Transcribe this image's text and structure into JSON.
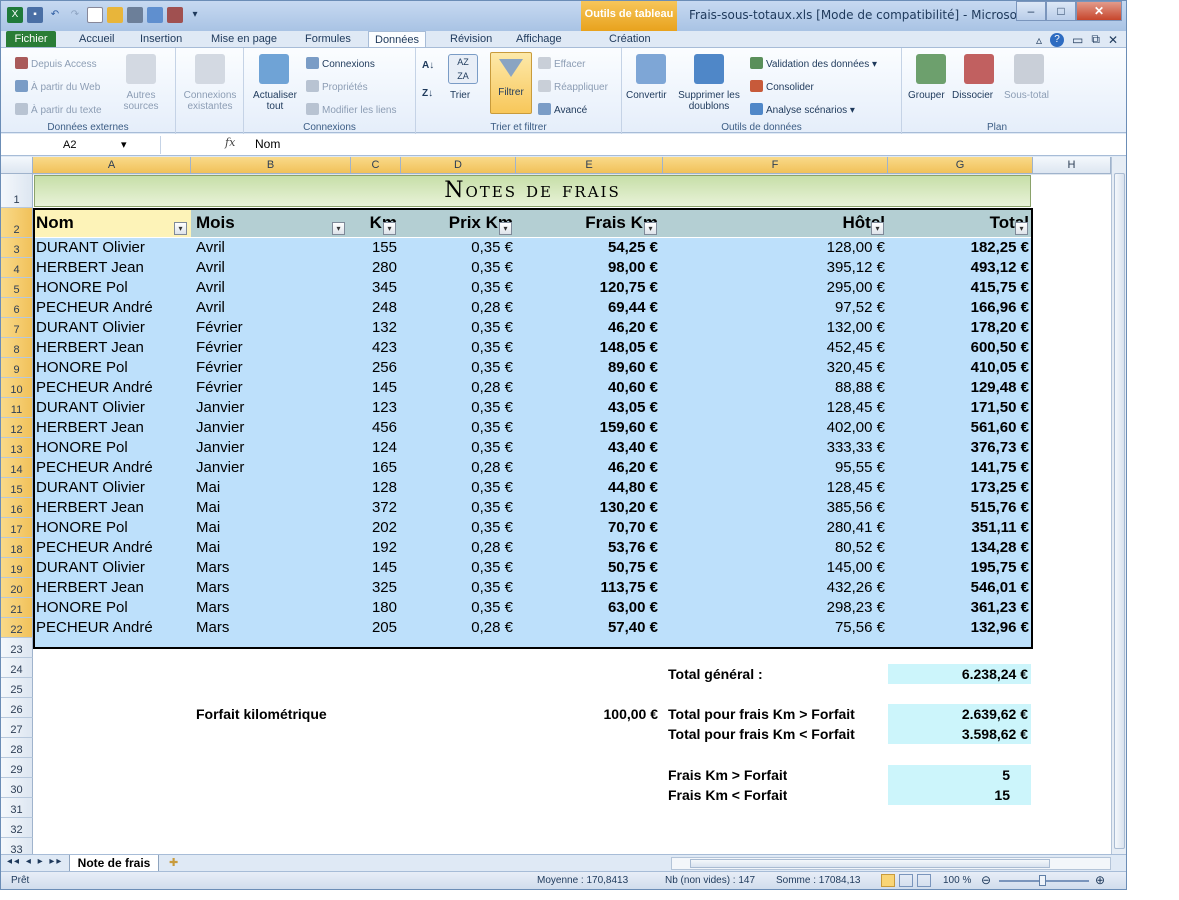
{
  "window": {
    "title": "Frais-sous-totaux.xls  [Mode de compatibilité] - Microsoft Ex...",
    "context_tab": "Outils de tableau"
  },
  "ribbon_tabs": [
    "Fichier",
    "Accueil",
    "Insertion",
    "Mise en page",
    "Formules",
    "Données",
    "Révision",
    "Affichage",
    "Création"
  ],
  "ribbon": {
    "external": {
      "label": "Données externes",
      "access": "Depuis Access",
      "web": "À partir du Web",
      "text": "À partir du texte",
      "other": "Autres sources"
    },
    "existing": "Connexions existantes",
    "connections": {
      "label": "Connexions",
      "refresh": "Actualiser tout",
      "conn": "Connexions",
      "props": "Propriétés",
      "edit": "Modifier les liens"
    },
    "sort": {
      "label": "Trier et filtrer",
      "sort": "Trier",
      "filter": "Filtrer",
      "clear": "Effacer",
      "reapply": "Réappliquer",
      "advanced": "Avancé"
    },
    "tools": {
      "label": "Outils de données",
      "convert": "Convertir",
      "dupes": "Supprimer les doublons",
      "validation": "Validation des données",
      "consolidate": "Consolider",
      "whatif": "Analyse scénarios"
    },
    "plan": {
      "label": "Plan",
      "group": "Grouper",
      "ungroup": "Dissocier",
      "subtotal": "Sous-total"
    }
  },
  "formula": {
    "cell": "A2",
    "fx": "fx",
    "value": "Nom"
  },
  "columns": [
    "A",
    "B",
    "C",
    "D",
    "E",
    "F",
    "G",
    "H"
  ],
  "sheet": {
    "title": "Notes de frais",
    "headers": [
      "Nom",
      "Mois",
      "Km",
      "Prix Km",
      "Frais Km",
      "Hôtel",
      "Total"
    ],
    "rows": [
      [
        "DURANT Olivier",
        "Avril",
        "155",
        "0,35 €",
        "54,25 €",
        "128,00 €",
        "182,25 €"
      ],
      [
        "HERBERT Jean",
        "Avril",
        "280",
        "0,35 €",
        "98,00 €",
        "395,12 €",
        "493,12 €"
      ],
      [
        "HONORE Pol",
        "Avril",
        "345",
        "0,35 €",
        "120,75 €",
        "295,00 €",
        "415,75 €"
      ],
      [
        "PECHEUR André",
        "Avril",
        "248",
        "0,28 €",
        "69,44 €",
        "97,52 €",
        "166,96 €"
      ],
      [
        "DURANT Olivier",
        "Février",
        "132",
        "0,35 €",
        "46,20 €",
        "132,00 €",
        "178,20 €"
      ],
      [
        "HERBERT Jean",
        "Février",
        "423",
        "0,35 €",
        "148,05 €",
        "452,45 €",
        "600,50 €"
      ],
      [
        "HONORE Pol",
        "Février",
        "256",
        "0,35 €",
        "89,60 €",
        "320,45 €",
        "410,05 €"
      ],
      [
        "PECHEUR André",
        "Février",
        "145",
        "0,28 €",
        "40,60 €",
        "88,88 €",
        "129,48 €"
      ],
      [
        "DURANT Olivier",
        "Janvier",
        "123",
        "0,35 €",
        "43,05 €",
        "128,45 €",
        "171,50 €"
      ],
      [
        "HERBERT Jean",
        "Janvier",
        "456",
        "0,35 €",
        "159,60 €",
        "402,00 €",
        "561,60 €"
      ],
      [
        "HONORE Pol",
        "Janvier",
        "124",
        "0,35 €",
        "43,40 €",
        "333,33 €",
        "376,73 €"
      ],
      [
        "PECHEUR André",
        "Janvier",
        "165",
        "0,28 €",
        "46,20 €",
        "95,55 €",
        "141,75 €"
      ],
      [
        "DURANT Olivier",
        "Mai",
        "128",
        "0,35 €",
        "44,80 €",
        "128,45 €",
        "173,25 €"
      ],
      [
        "HERBERT Jean",
        "Mai",
        "372",
        "0,35 €",
        "130,20 €",
        "385,56 €",
        "515,76 €"
      ],
      [
        "HONORE Pol",
        "Mai",
        "202",
        "0,35 €",
        "70,70 €",
        "280,41 €",
        "351,11 €"
      ],
      [
        "PECHEUR André",
        "Mai",
        "192",
        "0,28 €",
        "53,76 €",
        "80,52 €",
        "134,28 €"
      ],
      [
        "DURANT Olivier",
        "Mars",
        "145",
        "0,35 €",
        "50,75 €",
        "145,00 €",
        "195,75 €"
      ],
      [
        "HERBERT Jean",
        "Mars",
        "325",
        "0,35 €",
        "113,75 €",
        "432,26 €",
        "546,01 €"
      ],
      [
        "HONORE Pol",
        "Mars",
        "180",
        "0,35 €",
        "63,00 €",
        "298,23 €",
        "361,23 €"
      ],
      [
        "PECHEUR André",
        "Mars",
        "205",
        "0,28 €",
        "57,40 €",
        "75,56 €",
        "132,96 €"
      ]
    ],
    "summary": {
      "total_label": "Total général :",
      "total_value": "6.238,24 €",
      "forfait_label": "Forfait kilométrique",
      "forfait_value": "100,00 €",
      "over_label": "Total pour frais Km > Forfait",
      "over_value": "2.639,62 €",
      "under_label": "Total pour frais Km < Forfait",
      "under_value": "3.598,62 €",
      "count_over_label": "Frais Km > Forfait",
      "count_over_value": "5",
      "count_under_label": "Frais Km < Forfait",
      "count_under_value": "15"
    }
  },
  "sheet_tab": "Note de frais",
  "status": {
    "ready": "Prêt",
    "avg": "Moyenne : 170,8413",
    "count": "Nb (non vides) : 147",
    "sum": "Somme : 17084,13",
    "zoom": "100 %"
  }
}
